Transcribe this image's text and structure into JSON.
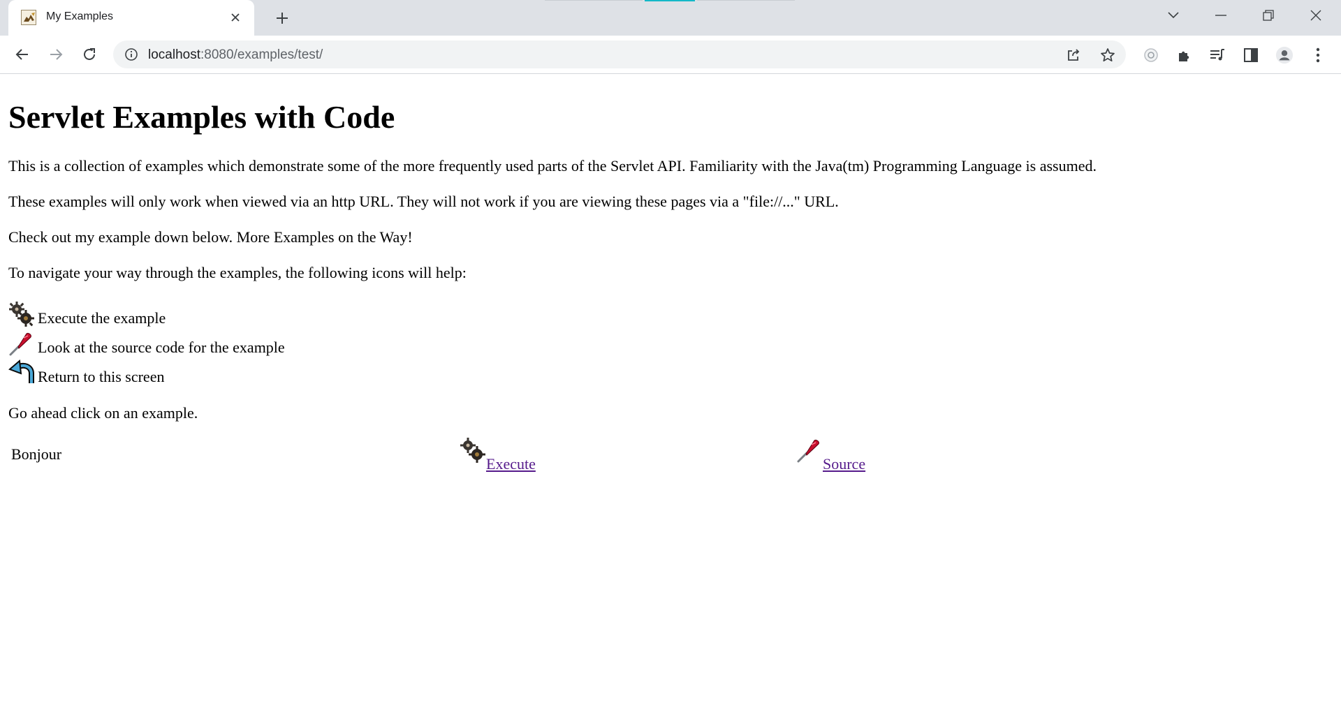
{
  "browser": {
    "tab_title": "My Examples",
    "url_host": "localhost",
    "url_path": ":8080/examples/test/",
    "icons": {
      "favicon": "tomcat-favicon",
      "tab_close": "close-icon",
      "new_tab": "plus-icon",
      "tab_search": "chevron-down-icon",
      "minimize": "minimize-icon",
      "restore": "restore-icon",
      "close_window": "close-icon",
      "back": "arrow-left-icon",
      "forward": "arrow-right-icon",
      "reload": "reload-icon",
      "site_info": "info-icon",
      "share": "share-icon",
      "bookmark": "star-icon",
      "extension": "extension-icon",
      "puzzle": "puzzle-icon",
      "media": "media-queue-icon",
      "side_panel": "side-panel-icon",
      "profile": "profile-avatar-icon",
      "menu": "kebab-menu-icon"
    },
    "accent_color": "#14b8c8"
  },
  "page": {
    "heading": "Servlet Examples with Code",
    "paragraphs": [
      "This is a collection of examples which demonstrate some of the more frequently used parts of the Servlet API. Familiarity with the Java(tm) Programming Language is assumed.",
      "These examples will only work when viewed via an http URL. They will not work if you are viewing these pages via a \"file://...\" URL.",
      "Check out my example down below. More Examples on the Way!",
      "To navigate your way through the examples, the following icons will help:"
    ],
    "legend": [
      {
        "icon": "gears-execute-icon",
        "text": "Execute the example"
      },
      {
        "icon": "screwdriver-source-icon",
        "text": "Look at the source code for the example"
      },
      {
        "icon": "return-arrow-icon",
        "text": "Return to this screen"
      }
    ],
    "closing": "Go ahead click on an example.",
    "examples": [
      {
        "name": "Bonjour",
        "execute_label": "Execute",
        "source_label": "Source"
      }
    ],
    "link_color": "#551a8b"
  }
}
